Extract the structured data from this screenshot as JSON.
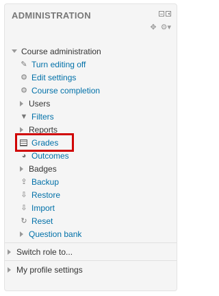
{
  "block": {
    "title": "ADMINISTRATION",
    "controls": {
      "minimize_icon": "minimize-icon",
      "dock_icon": "dock-icon",
      "move_icon": "move-icon",
      "actions_icon": "gear-menu-icon"
    }
  },
  "course_admin": {
    "label": "Course administration",
    "items": [
      {
        "label": "Turn editing off",
        "icon": "pencil-icon"
      },
      {
        "label": "Edit settings",
        "icon": "gear-icon"
      },
      {
        "label": "Course completion",
        "icon": "gear-icon"
      },
      {
        "label": "Users",
        "icon": "collapsed-arrow"
      },
      {
        "label": "Filters",
        "icon": "filter-icon"
      },
      {
        "label": "Reports",
        "icon": "collapsed-arrow"
      },
      {
        "label": "Grades",
        "icon": "grades-table-icon",
        "highlighted": true
      },
      {
        "label": "Outcomes",
        "icon": "outcomes-icon"
      },
      {
        "label": "Badges",
        "icon": "collapsed-arrow"
      },
      {
        "label": "Backup",
        "icon": "backup-icon"
      },
      {
        "label": "Restore",
        "icon": "restore-icon"
      },
      {
        "label": "Import",
        "icon": "import-icon"
      },
      {
        "label": "Reset",
        "icon": "reset-icon"
      },
      {
        "label": "Question bank",
        "icon": "collapsed-arrow"
      }
    ]
  },
  "switch_role": {
    "label": "Switch role to..."
  },
  "profile_settings": {
    "label": "My profile settings"
  },
  "colors": {
    "link": "#0070a8",
    "highlight": "#d00000"
  }
}
